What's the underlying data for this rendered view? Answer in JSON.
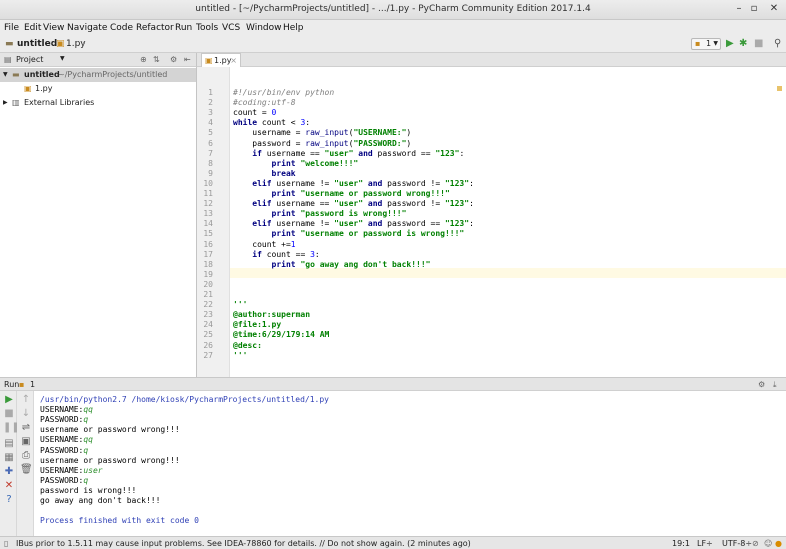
{
  "window": {
    "title": "untitled - [~/PycharmProjects/untitled] - .../1.py - PyCharm Community Edition 2017.1.4",
    "controls": [
      "–",
      "▫",
      "✕"
    ]
  },
  "menu": [
    "File",
    "Edit",
    "View",
    "Navigate",
    "Code",
    "Refactor",
    "Run",
    "Tools",
    "VCS",
    "Window",
    "Help"
  ],
  "navbar": {
    "project": "untitled",
    "file": "1.py",
    "run_config": "1"
  },
  "project_panel": {
    "title": "Project",
    "root_name": "untitled",
    "root_path": "~/PycharmProjects/untitled",
    "file": "1.py",
    "libraries": "External Libraries"
  },
  "editor": {
    "tab": "1.py",
    "lines": [
      {
        "n": "1",
        "text": "#!/usr/bin/env python"
      },
      {
        "n": "2",
        "text": "#coding:utf-8"
      },
      {
        "n": "3",
        "text": "count = 0"
      },
      {
        "n": "4",
        "text": "while count < 3:"
      },
      {
        "n": "5",
        "text": "    username = raw_input(\"USERNAME:\")"
      },
      {
        "n": "6",
        "text": "    password = raw_input(\"PASSWORD:\")"
      },
      {
        "n": "7",
        "text": "    if username == \"user\" and password == \"123\":"
      },
      {
        "n": "8",
        "text": "        print \"welcome!!!\""
      },
      {
        "n": "9",
        "text": "        break"
      },
      {
        "n": "10",
        "text": "    elif username != \"user\" and password != \"123\":"
      },
      {
        "n": "11",
        "text": "        print \"username or password wrong!!!\""
      },
      {
        "n": "12",
        "text": "    elif username == \"user\" and password != \"123\":"
      },
      {
        "n": "13",
        "text": "        print \"password is wrong!!!\""
      },
      {
        "n": "14",
        "text": "    elif username != \"user\" and password == \"123\":"
      },
      {
        "n": "15",
        "text": "        print \"username or password is wrong!!!\""
      },
      {
        "n": "16",
        "text": "    count +=1"
      },
      {
        "n": "17",
        "text": "    if count == 3:"
      },
      {
        "n": "18",
        "text": "        print \"go away ang don't back!!!\""
      },
      {
        "n": "19",
        "text": ""
      },
      {
        "n": "20",
        "text": ""
      },
      {
        "n": "21",
        "text": ""
      },
      {
        "n": "22",
        "text": "'''"
      },
      {
        "n": "23",
        "text": "@author:superman"
      },
      {
        "n": "24",
        "text": "@file:1.py"
      },
      {
        "n": "25",
        "text": "@time:6/29/179:14 AM"
      },
      {
        "n": "26",
        "text": "@desc:"
      },
      {
        "n": "27",
        "text": "'''"
      }
    ]
  },
  "run_panel": {
    "label": "Run",
    "config": "1",
    "output": [
      {
        "text": "/usr/bin/python2.7 /home/kiosk/PycharmProjects/untitled/1.py",
        "kind": "cmd"
      },
      {
        "text": "USERNAME:",
        "input": "qq"
      },
      {
        "text": "PASSWORD:",
        "input": "q"
      },
      {
        "text": "username or password wrong!!!"
      },
      {
        "text": "USERNAME:",
        "input": "qq"
      },
      {
        "text": "PASSWORD:",
        "input": "q"
      },
      {
        "text": "username or password wrong!!!"
      },
      {
        "text": "USERNAME:",
        "input": "user"
      },
      {
        "text": "PASSWORD:",
        "input": "q"
      },
      {
        "text": "password is wrong!!!"
      },
      {
        "text": "go away ang don't back!!!"
      },
      {
        "text": ""
      },
      {
        "text": "Process finished with exit code 0",
        "kind": "cmd"
      }
    ]
  },
  "status_bar": {
    "message": "IBus prior to 1.5.11 may cause input problems. See IDEA-78860 for details. // Do not show again. (2 minutes ago)",
    "position": "19:1",
    "line_sep": "LF÷",
    "encoding": "UTF-8÷"
  }
}
